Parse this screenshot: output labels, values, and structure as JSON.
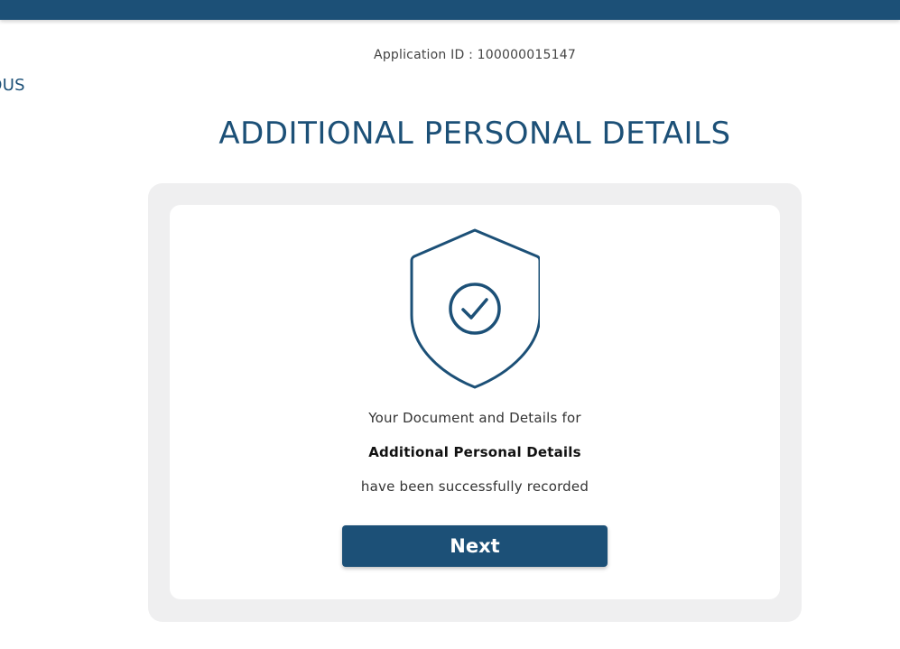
{
  "header": {
    "application_id": "Application ID : 100000015147",
    "previous_label": "VIOUS"
  },
  "page": {
    "title": "ADDITIONAL PERSONAL DETAILS"
  },
  "success_card": {
    "icon": "shield-check-icon",
    "line_1": "Your Document and Details for",
    "line_2": "Additional Personal Details",
    "line_3": "have been successfully recorded",
    "next_label": "Next"
  },
  "colors": {
    "brand": "#1c5077",
    "panel_background": "#efeff0"
  }
}
